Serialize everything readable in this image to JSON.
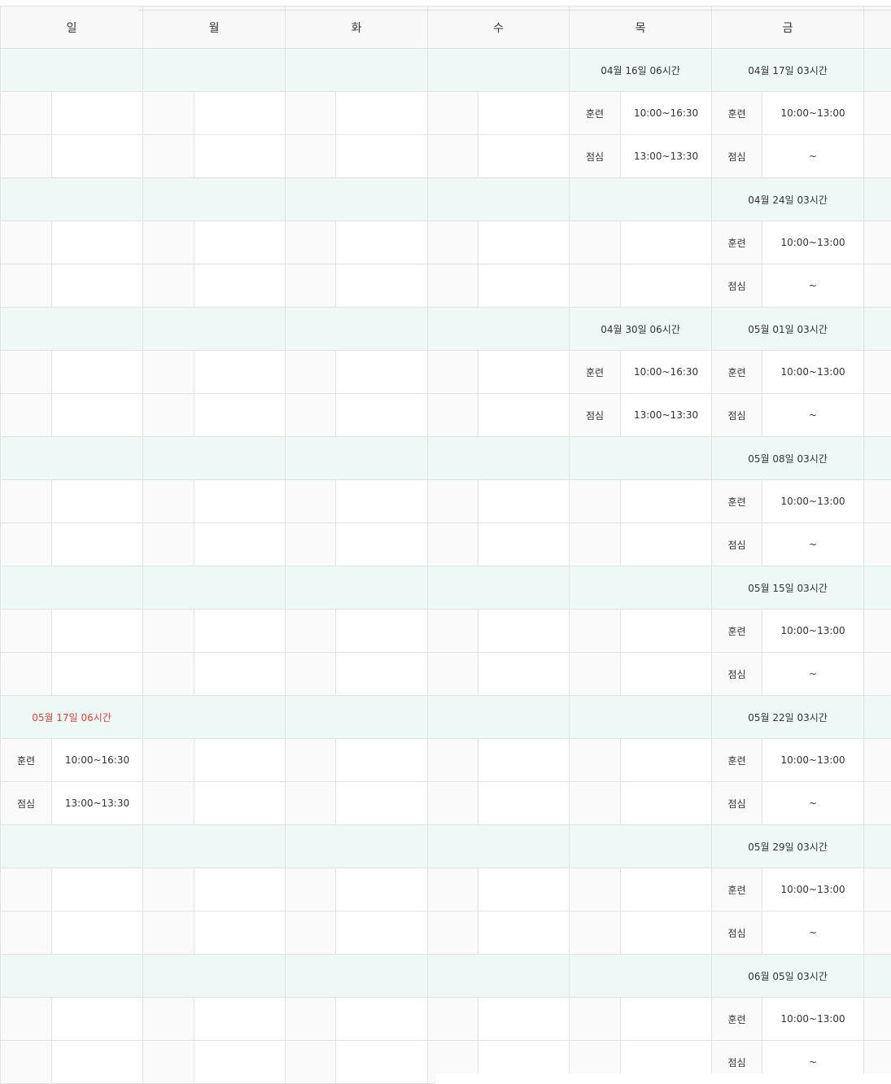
{
  "days": [
    "일",
    "월",
    "화",
    "수",
    "목",
    "금",
    ""
  ],
  "weeks": [
    {
      "dates": [
        "",
        "",
        "",
        "",
        "04월 16일 06시간",
        "04월 17일 03시간",
        ""
      ],
      "rows": [
        [
          [
            "",
            ""
          ],
          [
            "",
            ""
          ],
          [
            "",
            ""
          ],
          [
            "",
            ""
          ],
          [
            "훈련",
            "10:00~16:30"
          ],
          [
            "훈련",
            "10:00~13:00"
          ],
          [
            "",
            ""
          ]
        ],
        [
          [
            "",
            ""
          ],
          [
            "",
            ""
          ],
          [
            "",
            ""
          ],
          [
            "",
            ""
          ],
          [
            "점심",
            "13:00~13:30"
          ],
          [
            "점심",
            "~"
          ],
          [
            "",
            ""
          ]
        ]
      ]
    },
    {
      "dates": [
        "",
        "",
        "",
        "",
        "",
        "04월 24일 03시간",
        ""
      ],
      "rows": [
        [
          [
            "",
            ""
          ],
          [
            "",
            ""
          ],
          [
            "",
            ""
          ],
          [
            "",
            ""
          ],
          [
            "",
            ""
          ],
          [
            "훈련",
            "10:00~13:00"
          ],
          [
            "",
            ""
          ]
        ],
        [
          [
            "",
            ""
          ],
          [
            "",
            ""
          ],
          [
            "",
            ""
          ],
          [
            "",
            ""
          ],
          [
            "",
            ""
          ],
          [
            "점심",
            "~"
          ],
          [
            "",
            ""
          ]
        ]
      ]
    },
    {
      "dates": [
        "",
        "",
        "",
        "",
        "04월 30일 06시간",
        "05월 01일 03시간",
        ""
      ],
      "rows": [
        [
          [
            "",
            ""
          ],
          [
            "",
            ""
          ],
          [
            "",
            ""
          ],
          [
            "",
            ""
          ],
          [
            "훈련",
            "10:00~16:30"
          ],
          [
            "훈련",
            "10:00~13:00"
          ],
          [
            "",
            ""
          ]
        ],
        [
          [
            "",
            ""
          ],
          [
            "",
            ""
          ],
          [
            "",
            ""
          ],
          [
            "",
            ""
          ],
          [
            "점심",
            "13:00~13:30"
          ],
          [
            "점심",
            "~"
          ],
          [
            "",
            ""
          ]
        ]
      ]
    },
    {
      "dates": [
        "",
        "",
        "",
        "",
        "",
        "05월 08일 03시간",
        ""
      ],
      "rows": [
        [
          [
            "",
            ""
          ],
          [
            "",
            ""
          ],
          [
            "",
            ""
          ],
          [
            "",
            ""
          ],
          [
            "",
            ""
          ],
          [
            "훈련",
            "10:00~13:00"
          ],
          [
            "",
            ""
          ]
        ],
        [
          [
            "",
            ""
          ],
          [
            "",
            ""
          ],
          [
            "",
            ""
          ],
          [
            "",
            ""
          ],
          [
            "",
            ""
          ],
          [
            "점심",
            "~"
          ],
          [
            "",
            ""
          ]
        ]
      ]
    },
    {
      "dates": [
        "",
        "",
        "",
        "",
        "",
        "05월 15일 03시간",
        ""
      ],
      "rows": [
        [
          [
            "",
            ""
          ],
          [
            "",
            ""
          ],
          [
            "",
            ""
          ],
          [
            "",
            ""
          ],
          [
            "",
            ""
          ],
          [
            "훈련",
            "10:00~13:00"
          ],
          [
            "",
            ""
          ]
        ],
        [
          [
            "",
            ""
          ],
          [
            "",
            ""
          ],
          [
            "",
            ""
          ],
          [
            "",
            ""
          ],
          [
            "",
            ""
          ],
          [
            "점심",
            "~"
          ],
          [
            "",
            ""
          ]
        ]
      ]
    },
    {
      "dates": [
        "05월 17일 06시간",
        "",
        "",
        "",
        "",
        "05월 22일 03시간",
        ""
      ],
      "highlight_col": 0,
      "rows": [
        [
          [
            "훈련",
            "10:00~16:30"
          ],
          [
            "",
            ""
          ],
          [
            "",
            ""
          ],
          [
            "",
            ""
          ],
          [
            "",
            ""
          ],
          [
            "훈련",
            "10:00~13:00"
          ],
          [
            "",
            ""
          ]
        ],
        [
          [
            "점심",
            "13:00~13:30"
          ],
          [
            "",
            ""
          ],
          [
            "",
            ""
          ],
          [
            "",
            ""
          ],
          [
            "",
            ""
          ],
          [
            "점심",
            "~"
          ],
          [
            "",
            ""
          ]
        ]
      ]
    },
    {
      "dates": [
        "",
        "",
        "",
        "",
        "",
        "05월 29일 03시간",
        ""
      ],
      "rows": [
        [
          [
            "",
            ""
          ],
          [
            "",
            ""
          ],
          [
            "",
            ""
          ],
          [
            "",
            ""
          ],
          [
            "",
            ""
          ],
          [
            "훈련",
            "10:00~13:00"
          ],
          [
            "",
            ""
          ]
        ],
        [
          [
            "",
            ""
          ],
          [
            "",
            ""
          ],
          [
            "",
            ""
          ],
          [
            "",
            ""
          ],
          [
            "",
            ""
          ],
          [
            "점심",
            "~"
          ],
          [
            "",
            ""
          ]
        ]
      ]
    },
    {
      "dates": [
        "",
        "",
        "",
        "",
        "",
        "06월 05일 03시간",
        ""
      ],
      "rows": [
        [
          [
            "",
            ""
          ],
          [
            "",
            ""
          ],
          [
            "",
            ""
          ],
          [
            "",
            ""
          ],
          [
            "",
            ""
          ],
          [
            "훈련",
            "10:00~13:00"
          ],
          [
            "",
            ""
          ]
        ],
        [
          [
            "",
            ""
          ],
          [
            "",
            ""
          ],
          [
            "",
            ""
          ],
          [
            "",
            ""
          ],
          [
            "",
            ""
          ],
          [
            "점심",
            "~"
          ],
          [
            "",
            ""
          ]
        ]
      ]
    }
  ],
  "colors": {
    "header_bg": "#f8f8f8",
    "date_row_bg": "#eef8f6",
    "border": "#e3e3e3",
    "highlight_date": "#e8403a"
  }
}
